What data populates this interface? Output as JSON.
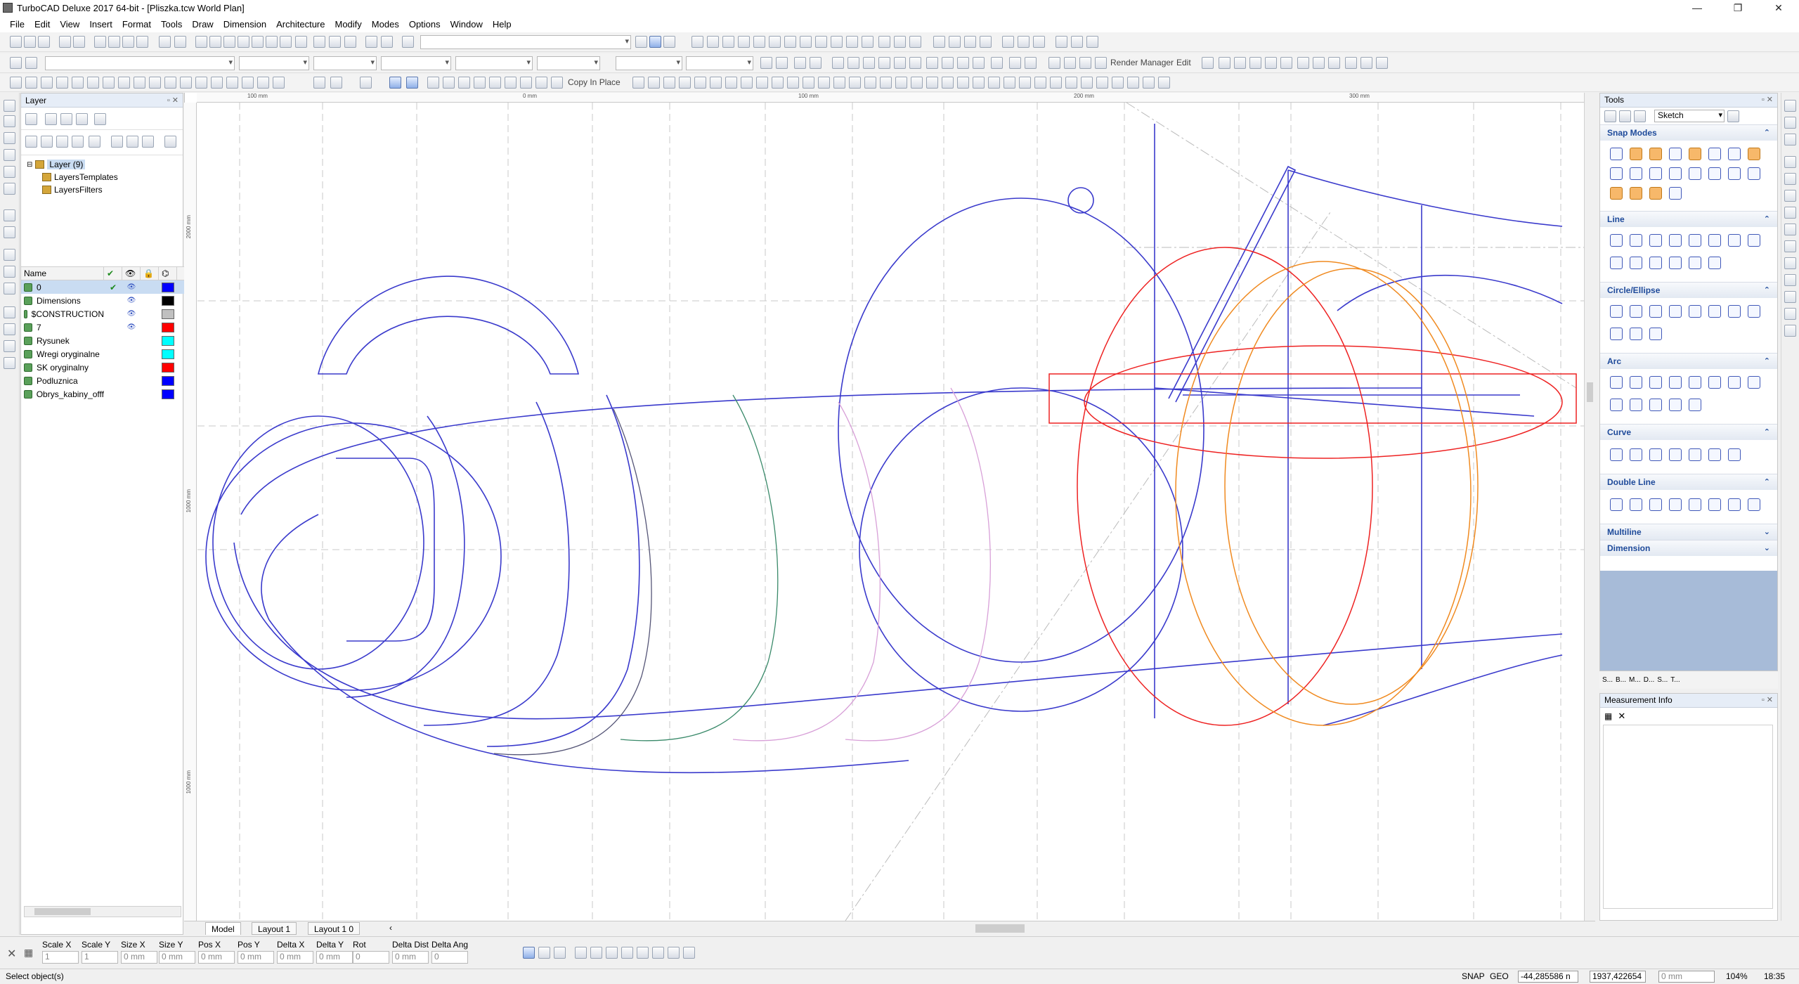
{
  "window": {
    "title": "TurboCAD Deluxe 2017 64-bit - [Pliszka.tcw World Plan]",
    "controls": [
      "—",
      "❐",
      "✕"
    ]
  },
  "menu": [
    "File",
    "Edit",
    "View",
    "Insert",
    "Format",
    "Tools",
    "Draw",
    "Dimension",
    "Architecture",
    "Modify",
    "Modes",
    "Options",
    "Window",
    "Help"
  ],
  "toolbar": {
    "copy_in_place": "Copy In Place",
    "render_manager": "Render Manager",
    "edit": "Edit"
  },
  "layer_panel": {
    "title": "Layer",
    "tree": {
      "root": "Layer (9)",
      "children": [
        "LayersTemplates",
        "LayersFilters"
      ]
    },
    "columns": [
      "Name",
      "✔",
      "👁",
      "🔒",
      "⌬"
    ],
    "layers": [
      {
        "name": "0",
        "visible": true,
        "color": "#0000ff"
      },
      {
        "name": "Dimensions",
        "visible": true,
        "color": "#000000"
      },
      {
        "name": "$CONSTRUCTION",
        "visible": true,
        "color": "#c0c0c0"
      },
      {
        "name": "7",
        "visible": true,
        "color": "#ff0000"
      },
      {
        "name": "Rysunek",
        "visible": false,
        "color": "#00ffff"
      },
      {
        "name": "Wregi oryginalne",
        "visible": false,
        "color": "#00ffff"
      },
      {
        "name": "SK oryginalny",
        "visible": false,
        "color": "#ff0000"
      },
      {
        "name": "Podluznica",
        "visible": false,
        "color": "#0000ff"
      },
      {
        "name": "Obrys_kabiny_offf",
        "visible": false,
        "color": "#0000ff"
      }
    ]
  },
  "ruler": {
    "top": [
      "100 mm",
      "0 mm",
      "100 mm",
      "200 mm",
      "300 mm"
    ],
    "left": [
      "2000 mm",
      "1000 mm",
      "1000 mm"
    ]
  },
  "tabs": [
    "Model",
    "Layout 1",
    "Layout 1 0"
  ],
  "tools_panel": {
    "title": "Tools",
    "mode": "Sketch",
    "sections": [
      {
        "name": "Snap Modes",
        "collapsed": false
      },
      {
        "name": "Line",
        "collapsed": false
      },
      {
        "name": "Circle/Ellipse",
        "collapsed": false
      },
      {
        "name": "Arc",
        "collapsed": false
      },
      {
        "name": "Curve",
        "collapsed": false
      },
      {
        "name": "Double Line",
        "collapsed": false
      },
      {
        "name": "Multiline",
        "collapsed": true
      },
      {
        "name": "Dimension",
        "collapsed": true
      }
    ],
    "bottom_tabs": [
      "S...",
      "B...",
      "M...",
      "D...",
      "S...",
      "T..."
    ]
  },
  "measurement": {
    "title": "Measurement Info"
  },
  "inspector": {
    "fields": [
      {
        "label": "Scale X",
        "value": "1"
      },
      {
        "label": "Scale Y",
        "value": "1"
      },
      {
        "label": "Size X",
        "value": "0 mm"
      },
      {
        "label": "Size Y",
        "value": "0 mm"
      },
      {
        "label": "Pos X",
        "value": "0 mm"
      },
      {
        "label": "Pos Y",
        "value": "0 mm"
      },
      {
        "label": "Delta X",
        "value": "0 mm"
      },
      {
        "label": "Delta Y",
        "value": "0 mm"
      },
      {
        "label": "Rot",
        "value": "0"
      },
      {
        "label": "Delta Dist",
        "value": "0 mm"
      },
      {
        "label": "Delta Ang",
        "value": "0"
      }
    ]
  },
  "status": {
    "message": "Select object(s)",
    "snap": "SNAP",
    "geo": "GEO",
    "coord_x": "-44,285586 n",
    "coord_y": "1937,422654",
    "coord_z": "0 mm",
    "zoom": "104%",
    "time": "18:35"
  }
}
